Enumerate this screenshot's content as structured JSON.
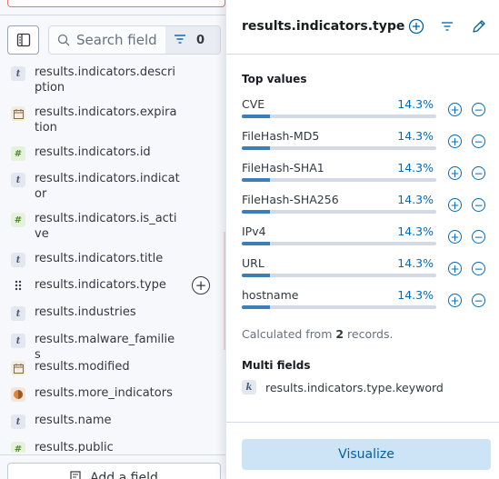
{
  "sidebar": {
    "search": {
      "placeholder": "Search field",
      "value": ""
    },
    "filter": {
      "count": "0"
    },
    "fields": [
      {
        "name": "results.indicators.description",
        "type": "t"
      },
      {
        "name": "results.indicators.expiration",
        "type": "date"
      },
      {
        "name": "results.indicators.id",
        "type": "#"
      },
      {
        "name": "results.indicators.indicator",
        "type": "t"
      },
      {
        "name": "results.indicators.is_active",
        "type": "#"
      },
      {
        "name": "results.indicators.title",
        "type": "t"
      },
      {
        "name": "results.indicators.type",
        "type": "drag"
      },
      {
        "name": "results.industries",
        "type": "t"
      },
      {
        "name": "results.malware_families",
        "type": "t"
      },
      {
        "name": "results.modified",
        "type": "date"
      },
      {
        "name": "results.more_indicators",
        "type": "object"
      },
      {
        "name": "results.name",
        "type": "t"
      },
      {
        "name": "results.public",
        "type": "#"
      }
    ],
    "add_field_label": "Add a field"
  },
  "popover": {
    "title": "results.indicators.type",
    "top_values_title": "Top values",
    "top_values": [
      {
        "label": "CVE",
        "percent": "14.3%",
        "fraction": 0.143
      },
      {
        "label": "FileHash-MD5",
        "percent": "14.3%",
        "fraction": 0.143
      },
      {
        "label": "FileHash-SHA1",
        "percent": "14.3%",
        "fraction": 0.143
      },
      {
        "label": "FileHash-SHA256",
        "percent": "14.3%",
        "fraction": 0.143
      },
      {
        "label": "IPv4",
        "percent": "14.3%",
        "fraction": 0.143
      },
      {
        "label": "URL",
        "percent": "14.3%",
        "fraction": 0.143
      },
      {
        "label": "hostname",
        "percent": "14.3%",
        "fraction": 0.143
      }
    ],
    "calc_prefix": "Calculated from ",
    "calc_count": "2",
    "calc_suffix": " records.",
    "multi_fields_title": "Multi fields",
    "multi_fields": [
      {
        "name": "results.indicators.type.keyword",
        "type": "k"
      }
    ],
    "visualize_label": "Visualize"
  }
}
